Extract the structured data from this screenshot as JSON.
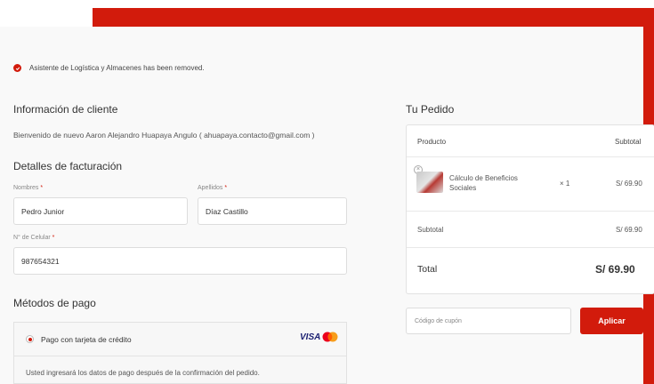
{
  "notice": {
    "message": "Asistente de Logística y Almacenes has been removed."
  },
  "customer": {
    "heading": "Información de cliente",
    "welcome": "Bienvenido de nuevo Aaron Alejandro Huapaya Angulo ( ahuapaya.contacto@gmail.com )"
  },
  "billing": {
    "heading": "Detalles de facturación",
    "first_name": {
      "label": "Nombres",
      "required_mark": "*",
      "value": "Pedro Junior"
    },
    "last_name": {
      "label": "Apellidos",
      "required_mark": "*",
      "value": "Díaz Castillo"
    },
    "phone": {
      "label": "N° de Celular",
      "required_mark": "*",
      "value": "987654321"
    }
  },
  "payment": {
    "heading": "Métodos de pago",
    "option_label": "Pago con tarjeta de crédito",
    "card_brand": "VISA",
    "description": "Usted ingresará los datos de pago después de la confirmación del pedido."
  },
  "order": {
    "heading": "Tu Pedido",
    "col_product": "Producto",
    "col_subtotal": "Subtotal",
    "item": {
      "name": "Cálculo de Beneficios Sociales",
      "qty": "× 1",
      "price": "S/ 69.90"
    },
    "subtotal_label": "Subtotal",
    "subtotal_value": "S/ 69.90",
    "total_label": "Total",
    "total_value": "S/ 69.90"
  },
  "coupon": {
    "placeholder": "Código de cupón",
    "apply_label": "Aplicar"
  },
  "colors": {
    "accent": "#d21b0c",
    "background": "#f9f9f9"
  }
}
